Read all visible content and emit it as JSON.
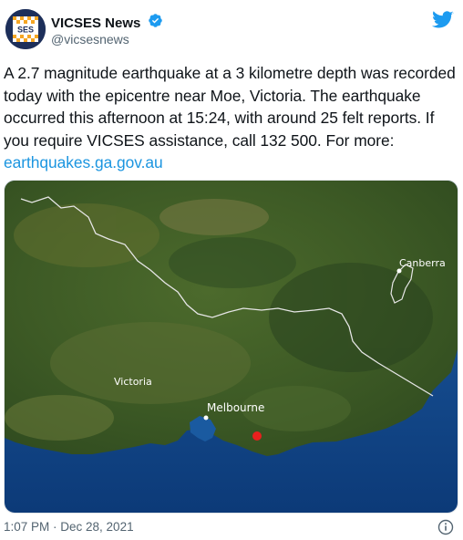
{
  "tweet": {
    "account_name": "VICSES News",
    "handle": "@vicsesnews",
    "avatar_text": "SES",
    "text_before_link": "A 2.7 magnitude earthquake at a 3 kilometre depth was recorded today with the epicentre near Moe, Victoria. The earthquake occurred this afternoon at 15:24, with around 25 felt reports. If you require VICSES assistance, call 132 500. For more: ",
    "link_text": "earthquakes.ga.gov.au",
    "timestamp": "1:07 PM · Dec 28, 2021"
  },
  "map": {
    "labels": {
      "canberra": "Canberra",
      "victoria": "Victoria",
      "melbourne": "Melbourne"
    },
    "epicentre_color": "#e8201d",
    "border_color": "#e6e6e6"
  },
  "icons": {
    "verified": "verified-badge-icon",
    "bird": "twitter-bird-icon",
    "info": "info-icon"
  },
  "colors": {
    "link": "#1b95e0",
    "verified": "#1d9bf0",
    "bird": "#1d9bf0",
    "muted": "#536471"
  }
}
